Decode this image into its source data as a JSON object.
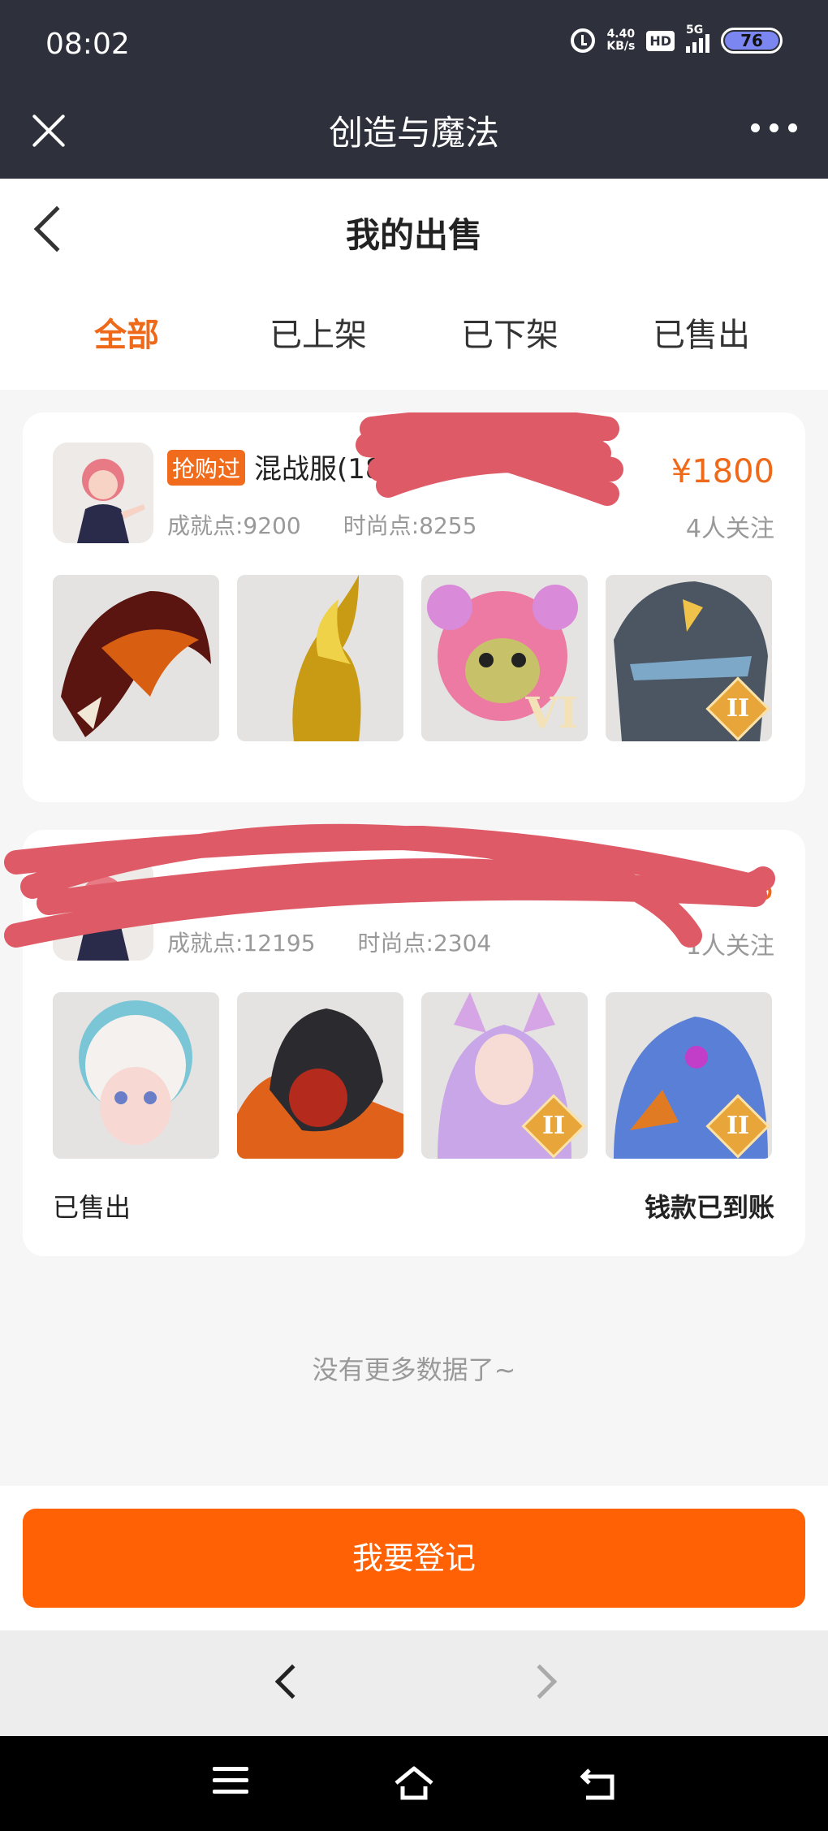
{
  "status_bar": {
    "time": "08:02",
    "speed_value": "4.40",
    "speed_unit": "KB/s",
    "hd": "HD",
    "network": "5G",
    "battery": "76"
  },
  "title_bar": {
    "title": "创造与魔法"
  },
  "page": {
    "title": "我的出售"
  },
  "tabs": [
    {
      "label": "全部",
      "active": true
    },
    {
      "label": "已上架",
      "active": false
    },
    {
      "label": "已下架",
      "active": false
    },
    {
      "label": "已售出",
      "active": false
    }
  ],
  "listings": [
    {
      "badge": "抢购过",
      "server": "混战服(184",
      "achievement": "成就点:9200",
      "fashion": "时尚点:8255",
      "price": "¥1800",
      "followers": "4人关注",
      "thumbs": [
        {
          "name": "red dragon mount",
          "tier": ""
        },
        {
          "name": "golden phoenix mount",
          "tier": ""
        },
        {
          "name": "pink bear mount",
          "tier": "VI"
        },
        {
          "name": "stone golem mount",
          "tier": "II"
        }
      ]
    },
    {
      "achievement": "成就点:12195",
      "fashion": "时尚点:2304",
      "price": "¥435",
      "followers": "1人关注",
      "thumbs": [
        {
          "name": "cloud sheep girl mount",
          "tier": ""
        },
        {
          "name": "black lion mount",
          "tier": ""
        },
        {
          "name": "fox spirit girl mount",
          "tier": "II"
        },
        {
          "name": "eagle beast mount",
          "tier": "II"
        }
      ],
      "status_left": "已售出",
      "status_right": "钱款已到账"
    }
  ],
  "footer": {
    "no_more": "没有更多数据了~",
    "register_button": "我要登记"
  },
  "colors": {
    "accent": "#ff6104",
    "title_bar": "#2e313c",
    "redaction": "#de5a66"
  }
}
